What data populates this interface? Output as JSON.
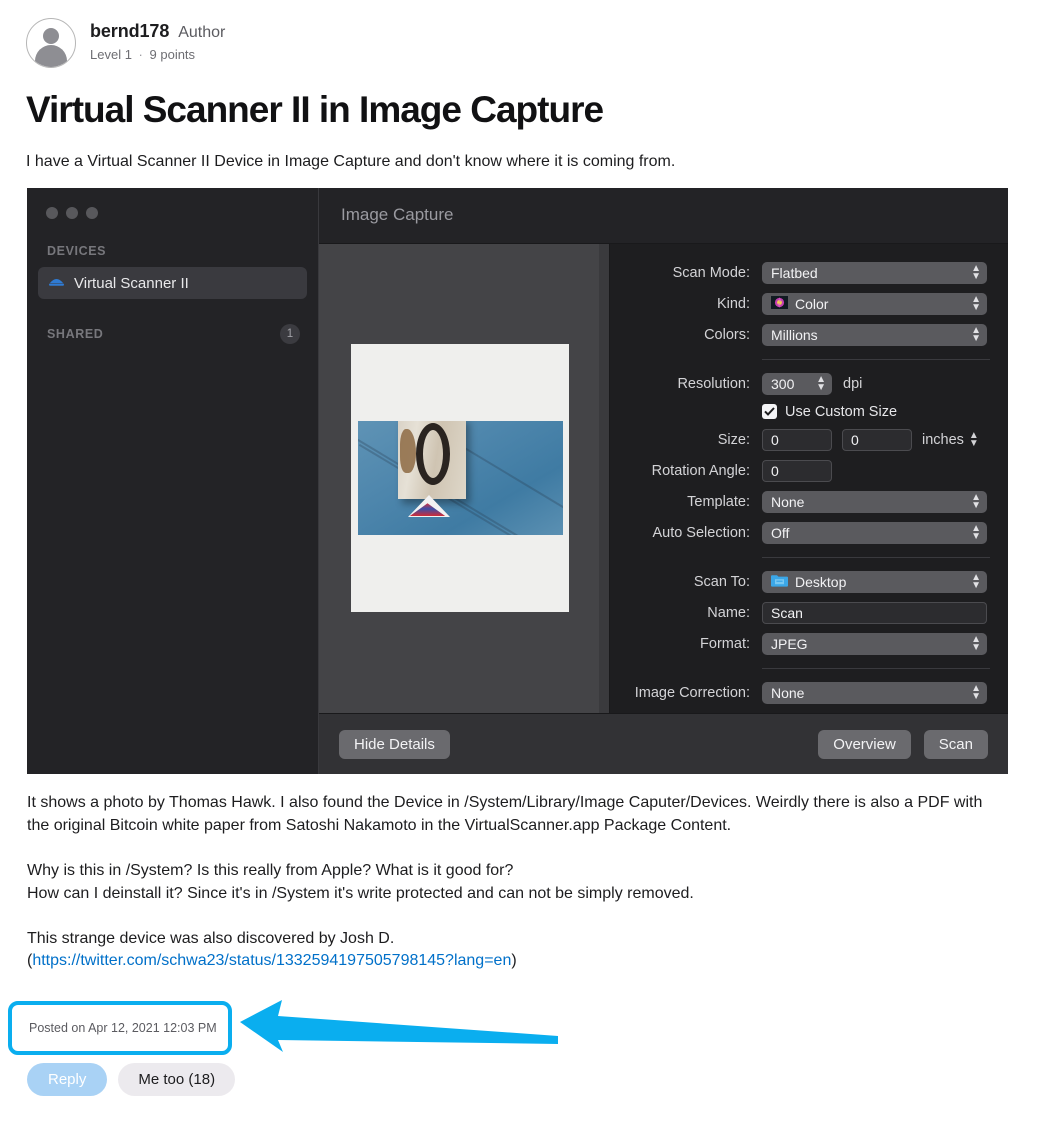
{
  "post": {
    "author": {
      "name": "bernd178",
      "role": "Author",
      "level": "Level 1",
      "separator": "·",
      "points": "9 points",
      "avatar_icon": "person-avatar-icon"
    },
    "title": "Virtual Scanner II in Image Capture",
    "intro": "I have a Virtual Scanner II Device in Image Capture and don't know where it is coming from.",
    "body": {
      "paragraph1": "It shows a photo by Thomas Hawk. I also found the Device in /System/Library/Image Caputer/Devices. Weirdly there is also a PDF with the original Bitcoin white paper from Satoshi Nakamoto in the VirtualScanner.app Package Content.",
      "paragraph2_line1": "Why is this in /System? Is this really from Apple? What is it good for?",
      "paragraph2_line2": "How can I deinstall it? Since it's in /System it's write protected and can not be simply removed.",
      "paragraph3_line1": "This  strange device was also discovered by Josh D.",
      "paragraph3_open_paren": "(",
      "paragraph3_link": "https://twitter.com/schwa23/status/1332594197505798145?lang=en",
      "paragraph3_close_paren": ")"
    },
    "timestamp": "Posted on Apr 12, 2021 12:03 PM",
    "actions": {
      "reply_label": "Reply",
      "me_too_label": "Me too (18)"
    }
  },
  "annotation": {
    "color": "#0aaeef",
    "arrow_icon": "left-arrow-annotation-icon"
  },
  "screenshot": {
    "window_title": "Image Capture",
    "traffic_lights": [
      "close",
      "minimize",
      "zoom"
    ],
    "sidebar": {
      "devices_heading": "DEVICES",
      "device_item": {
        "label": "Virtual Scanner II",
        "icon": "scanner-icon",
        "selected": true
      },
      "shared_heading": "SHARED",
      "shared_badge": "1"
    },
    "preview": {
      "image_description": "photo-preview"
    },
    "settings": [
      {
        "label": "Scan Mode:",
        "type": "popup",
        "value": "Flatbed"
      },
      {
        "label": "Kind:",
        "type": "popup",
        "value": "Color",
        "icon": "color-thumbnail-icon"
      },
      {
        "label": "Colors:",
        "type": "popup",
        "value": "Millions"
      },
      {
        "label": "Resolution:",
        "type": "stepper",
        "value": "300",
        "unit": "dpi"
      },
      {
        "label": "",
        "type": "checkbox",
        "value": "Use Custom Size",
        "checked": true
      },
      {
        "label": "Size:",
        "type": "size",
        "value_width": "0",
        "value_height": "0",
        "unit": "inches"
      },
      {
        "label": "Rotation Angle:",
        "type": "textfield",
        "value": "0"
      },
      {
        "label": "Template:",
        "type": "popup",
        "value": "None"
      },
      {
        "label": "Auto Selection:",
        "type": "popup",
        "value": "Off"
      },
      {
        "label": "Scan To:",
        "type": "popup",
        "value": "Desktop",
        "icon": "folder-icon"
      },
      {
        "label": "Name:",
        "type": "textfield",
        "value": "Scan"
      },
      {
        "label": "Format:",
        "type": "popup",
        "value": "JPEG"
      },
      {
        "label": "Image Correction:",
        "type": "popup",
        "value": "None"
      }
    ],
    "toolbar": {
      "hide_details_label": "Hide Details",
      "overview_label": "Overview",
      "scan_label": "Scan"
    }
  }
}
